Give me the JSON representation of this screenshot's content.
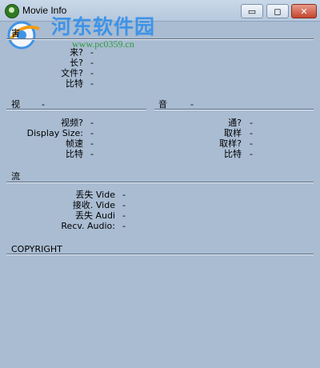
{
  "window": {
    "title": "Movie Info",
    "controls": {
      "minimize": "▭",
      "maximize": "◻",
      "close": "✕"
    }
  },
  "watermark": {
    "title": "河东软件园",
    "url": "www.pc0359.cn"
  },
  "general": {
    "partial_label": "害",
    "rows": [
      {
        "label": "来?",
        "value": "-"
      },
      {
        "label": "长?",
        "value": "-"
      },
      {
        "label": "文件?",
        "value": "-"
      },
      {
        "label": "比特",
        "value": "-"
      }
    ]
  },
  "video": {
    "title": "视",
    "title_value": "-",
    "rows": [
      {
        "label": "视频?",
        "value": "-"
      },
      {
        "label": "Display Size:",
        "value": "-"
      },
      {
        "label": "帧速",
        "value": "-"
      },
      {
        "label": "比特",
        "value": "-"
      }
    ]
  },
  "audio": {
    "title": "音",
    "title_value": "-",
    "rows": [
      {
        "label": "通?",
        "value": "-"
      },
      {
        "label": "取样",
        "value": "-"
      },
      {
        "label": "取样?",
        "value": "-"
      },
      {
        "label": "比特",
        "value": "-"
      }
    ]
  },
  "stream": {
    "title": "流",
    "rows": [
      {
        "label": "丢失 Vide",
        "value": "-"
      },
      {
        "label": "接收. Vide",
        "value": "-"
      },
      {
        "label": "丢失 Audi",
        "value": "-"
      },
      {
        "label": "Recv. Audio:",
        "value": "-"
      }
    ]
  },
  "copyright": {
    "title": "COPYRIGHT"
  },
  "colors": {
    "background": "#a9bcd2",
    "titlebar": "#c1d2e6",
    "watermark_blue": "#3f93e6",
    "watermark_green": "#2f9a3a",
    "close_button": "#c3462e"
  },
  "icons": [
    "app-icon",
    "minimize-icon",
    "maximize-icon",
    "close-icon",
    "watermark-logo"
  ]
}
